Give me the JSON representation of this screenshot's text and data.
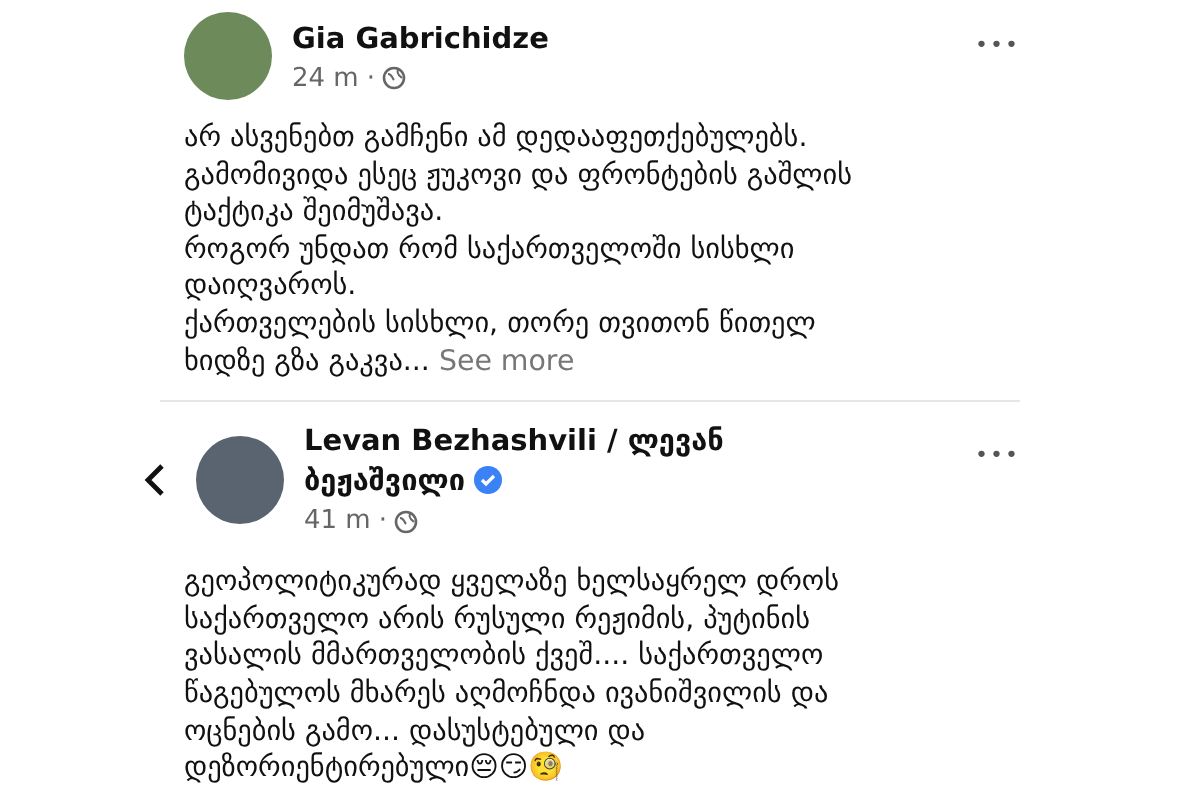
{
  "posts": [
    {
      "author": "Gia Gabrichidze",
      "verified": false,
      "back_button": false,
      "time": "24 m",
      "separator": "·",
      "menu": "•••",
      "text": "არ ასვენებთ გამჩენი ამ დედააფეთქებულებს.\nგამომივიდა ესეც ჟუკოვი და ფრონტების გაშლის\nტაქტიკა შეიმუშავა.\nროგორ უნდათ რომ საქართველოში სისხლი\nდაიღვაროს.\nქართველების სისხლი, თორე თვითონ წითელ\nხიდზე გზა გაკვა...",
      "see_more": "See more"
    },
    {
      "author": "Levan Bezhashvili / ლევან\nბეჟაშვილი",
      "verified": true,
      "back_button": true,
      "time": "41 m",
      "separator": "·",
      "menu": "•••",
      "text": "გეოპოლიტიკურად ყველაზე ხელსაყრელ დროს\nსაქართველო არის რუსული რეჟიმის, პუტინის\nვასალის მმართველობის ქვეშ.... საქართველო\nწაგებულოს მხარეს აღმოჩნდა ივანიშვილის და\nოცნების გამო... დასუსტებული და\nდეზორიენტირებული😔😏🧐"
    }
  ]
}
